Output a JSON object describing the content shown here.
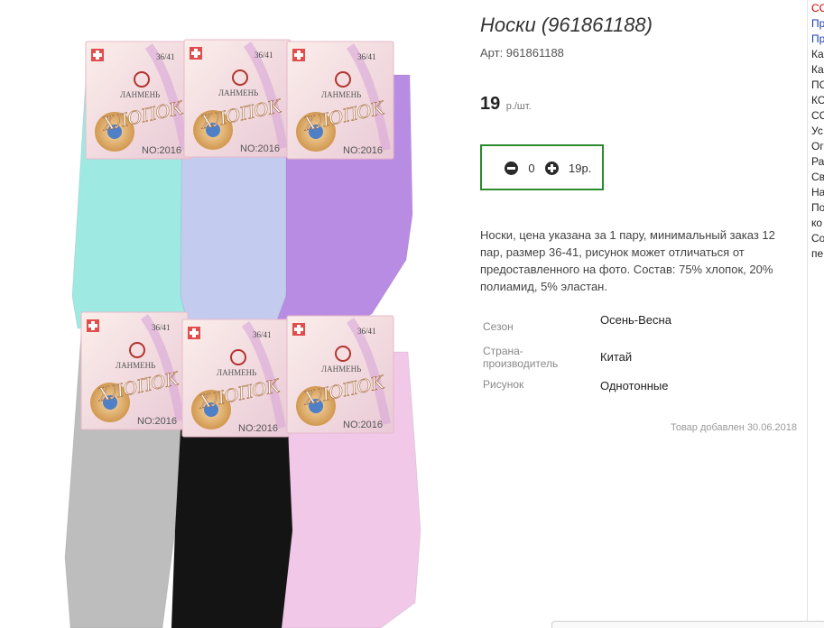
{
  "product": {
    "title": "Носки (961861188)",
    "sku": "Арт: 961861188",
    "price": "19",
    "price_unit": "р./шт.",
    "quantity": "0",
    "quantity_total": "19р.",
    "description": "Носки, цена указана за 1 пару, минимальный заказ 12 пар, размер 36-41, рисунок может отличаться от предоставленного на фото. Состав: 75% хлопок, 20% полиамид, 5% эластан.",
    "specs": [
      {
        "label": "Сезон",
        "value": "Осень-Весна"
      },
      {
        "label": "Страна-производитель",
        "value": "Китай"
      },
      {
        "label": "Рисунок",
        "value": "Однотонные"
      }
    ],
    "added_date": "Товар добавлен 30.06.2018"
  },
  "photo": {
    "brand_label": "ЛАНМЕНЬ",
    "product_label": "ХЛОПОК",
    "size_label": "36/41",
    "code_label": "NO:2016",
    "sock_colors": [
      "#9fe9e3",
      "#c3cbef",
      "#b98ce3",
      "#bdbdbd",
      "#141414",
      "#f2c8e8"
    ],
    "tag_color": "#f6e2df"
  },
  "sidebar": {
    "items": [
      {
        "label": "СС",
        "color": "red"
      },
      {
        "label": "Пр",
        "color": "blue"
      },
      {
        "label": "Пр",
        "color": "blue"
      },
      {
        "label": "Ка",
        "color": "dark"
      },
      {
        "label": "Ка",
        "color": "dark"
      },
      {
        "label": "ПС",
        "color": "dark"
      },
      {
        "label": "КС",
        "color": "dark"
      },
      {
        "label": "СС",
        "color": "dark"
      },
      {
        "label": "Ус",
        "color": "dark"
      },
      {
        "label": "Ог",
        "color": "dark"
      },
      {
        "label": "Ра",
        "color": "dark"
      },
      {
        "label": "Св",
        "color": "dark"
      },
      {
        "label": "На",
        "color": "dark"
      },
      {
        "label": "По",
        "color": "dark"
      },
      {
        "label": "ко",
        "color": "dark"
      },
      {
        "label": "Со",
        "color": "dark"
      },
      {
        "label": "пе",
        "color": "dark"
      }
    ]
  }
}
